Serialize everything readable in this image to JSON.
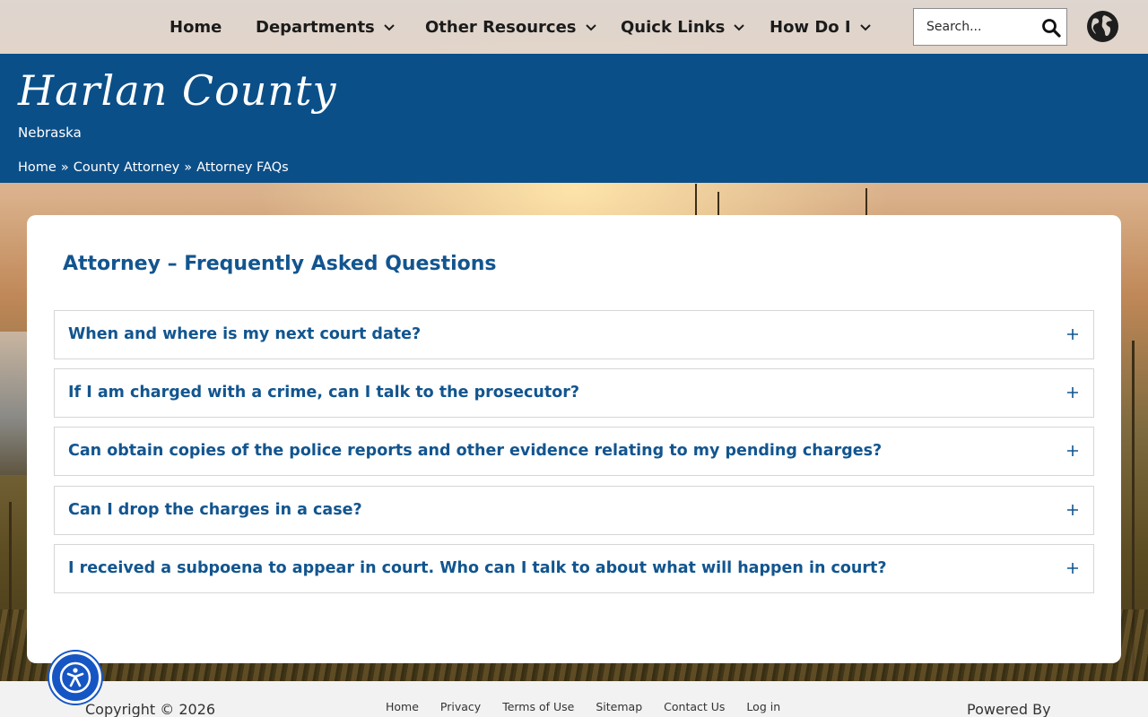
{
  "nav": {
    "items": [
      {
        "label": "Home",
        "has_dropdown": false
      },
      {
        "label": "Departments",
        "has_dropdown": true
      },
      {
        "label": "Other Resources",
        "has_dropdown": true
      },
      {
        "label": "Quick Links",
        "has_dropdown": true
      },
      {
        "label": "How Do I",
        "has_dropdown": true
      }
    ],
    "search_placeholder": "Search...",
    "icons": {
      "search": "search-icon",
      "language": "globe-icon",
      "dropdown": "chevron-down-icon"
    }
  },
  "header": {
    "site_title": "Harlan County",
    "site_subtitle": "Nebraska",
    "breadcrumb": [
      "Home",
      "County Attorney",
      "Attorney FAQs"
    ],
    "breadcrumb_separator": "»",
    "colors": {
      "background": "#0b4f88",
      "text": "#ffffff"
    }
  },
  "main": {
    "title": "Attorney – Frequently Asked Questions",
    "faqs": [
      {
        "question": "When and where is my next court date?",
        "expanded": false
      },
      {
        "question": "If I am charged with a crime, can I talk to the prosecutor?",
        "expanded": false
      },
      {
        "question": "Can obtain copies of the police reports and other evidence relating to my pending charges?",
        "expanded": false
      },
      {
        "question": "Can I drop the charges in a case?",
        "expanded": false
      },
      {
        "question": "I received a subpoena to appear in court. Who can I talk to about what will happen in court?",
        "expanded": false
      }
    ],
    "colors": {
      "accent": "#12558f",
      "border": "#d6d6d6"
    }
  },
  "footer": {
    "copyright": "Copyright © 2026",
    "links": [
      "Home",
      "Privacy",
      "Terms of Use",
      "Sitemap",
      "Contact Us",
      "Log in"
    ],
    "powered_by": "Powered By"
  },
  "accessibility": {
    "icon": "accessibility-icon",
    "color": "#1656c4"
  }
}
